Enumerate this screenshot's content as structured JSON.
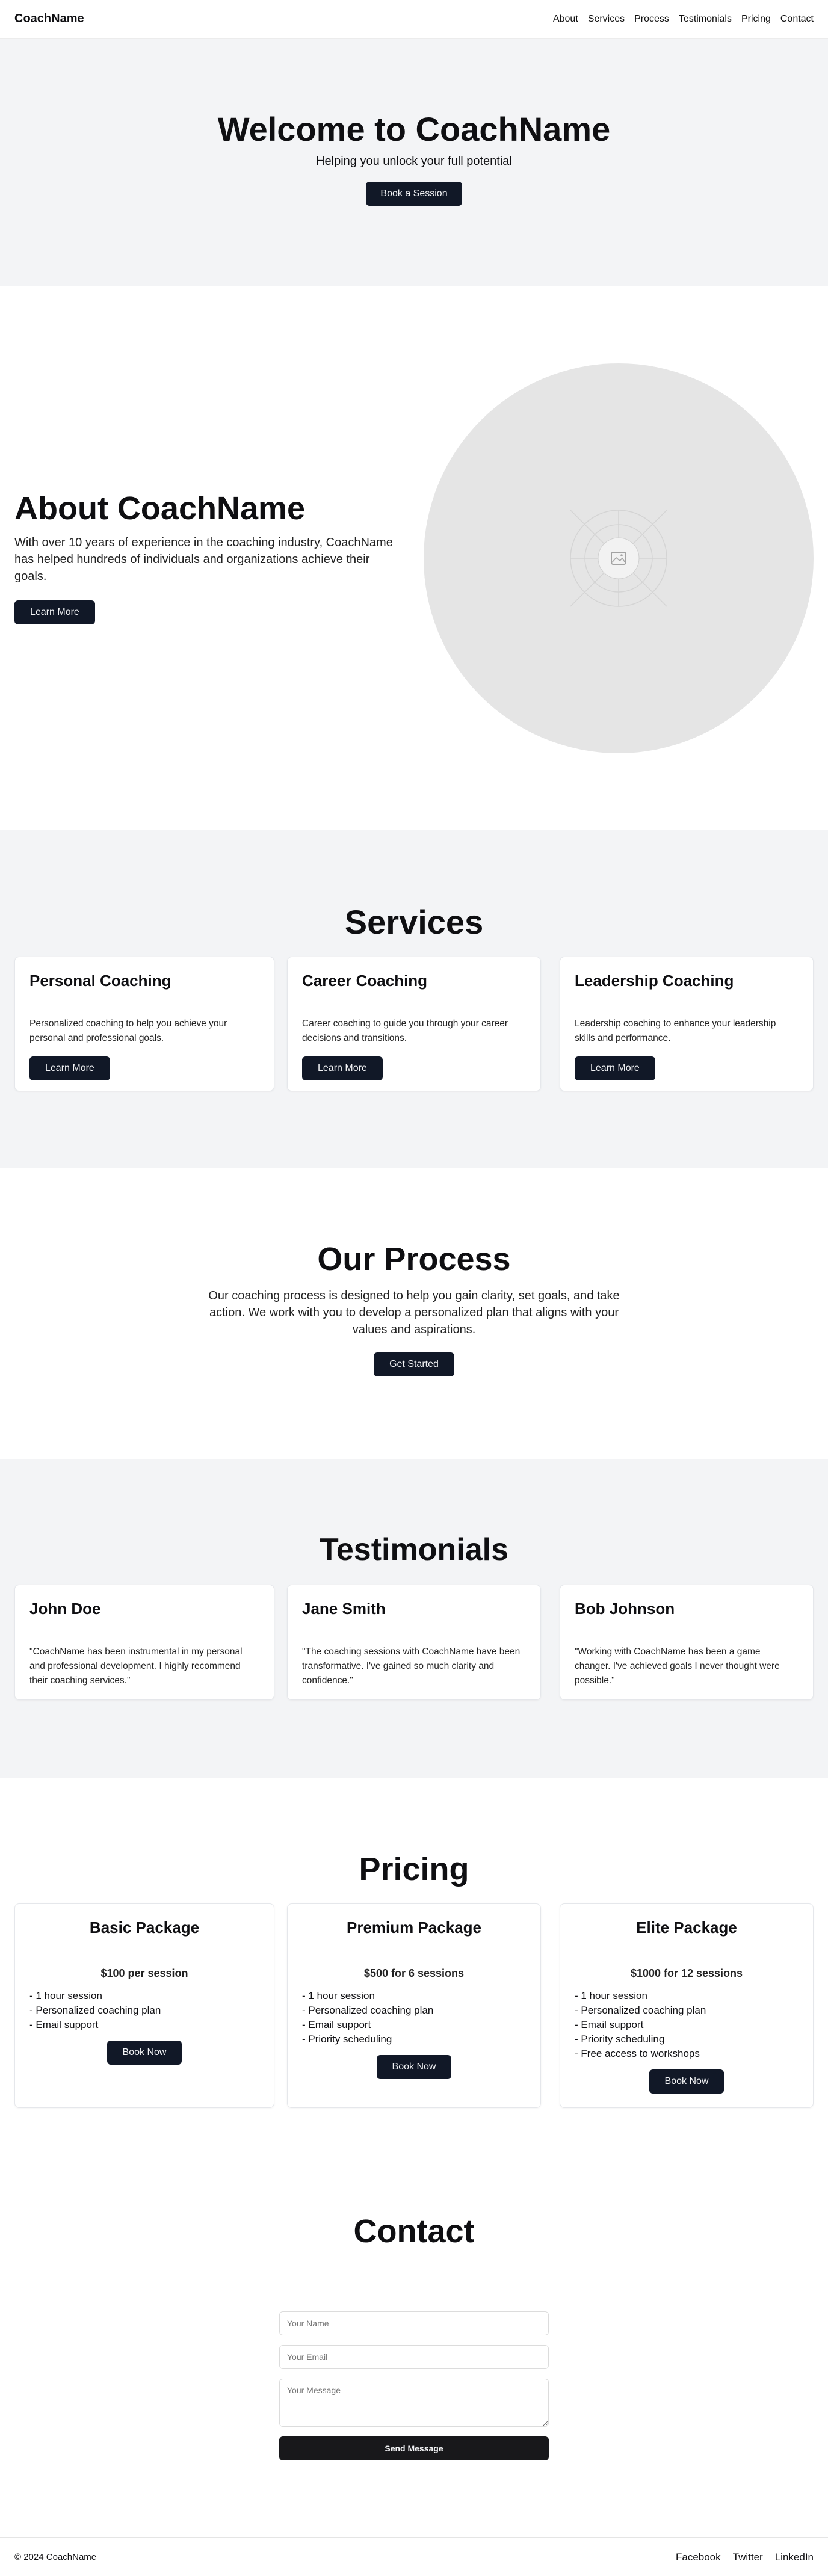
{
  "header": {
    "logo": "CoachName",
    "nav": [
      "About",
      "Services",
      "Process",
      "Testimonials",
      "Pricing",
      "Contact"
    ]
  },
  "hero": {
    "title": "Welcome to CoachName",
    "subtitle": "Helping you unlock your full potential",
    "cta": "Book a Session"
  },
  "about": {
    "title": "About CoachName",
    "text": "With over 10 years of experience in the coaching industry, CoachName has helped hundreds of individuals and organizations achieve their goals.",
    "cta": "Learn More",
    "image_icon": "image-placeholder-icon"
  },
  "services": {
    "title": "Services",
    "items": [
      {
        "title": "Personal Coaching",
        "text": "Personalized coaching to help you achieve your personal and professional goals.",
        "cta": "Learn More"
      },
      {
        "title": "Career Coaching",
        "text": "Career coaching to guide you through your career decisions and transitions.",
        "cta": "Learn More"
      },
      {
        "title": "Leadership Coaching",
        "text": "Leadership coaching to enhance your leadership skills and performance.",
        "cta": "Learn More"
      }
    ]
  },
  "process": {
    "title": "Our Process",
    "text": "Our coaching process is designed to help you gain clarity, set goals, and take action. We work with you to develop a personalized plan that aligns with your values and aspirations.",
    "cta": "Get Started"
  },
  "testimonials": {
    "title": "Testimonials",
    "items": [
      {
        "name": "John Doe",
        "quote": "\"CoachName has been instrumental in my personal and professional development. I highly recommend their coaching services.\""
      },
      {
        "name": "Jane Smith",
        "quote": "\"The coaching sessions with CoachName have been transformative. I've gained so much clarity and confidence.\""
      },
      {
        "name": "Bob Johnson",
        "quote": "\"Working with CoachName has been a game changer. I've achieved goals I never thought were possible.\""
      }
    ]
  },
  "pricing": {
    "title": "Pricing",
    "items": [
      {
        "name": "Basic Package",
        "price": "$100 per session",
        "features": [
          "- 1 hour session",
          "- Personalized coaching plan",
          "- Email support"
        ],
        "cta": "Book Now"
      },
      {
        "name": "Premium Package",
        "price": "$500 for 6 sessions",
        "features": [
          "- 1 hour session",
          "- Personalized coaching plan",
          "- Email support",
          "- Priority scheduling"
        ],
        "cta": "Book Now"
      },
      {
        "name": "Elite Package",
        "price": "$1000 for 12 sessions",
        "features": [
          "- 1 hour session",
          "- Personalized coaching plan",
          "- Email support",
          "- Priority scheduling",
          "- Free access to workshops"
        ],
        "cta": "Book Now"
      }
    ]
  },
  "contact": {
    "title": "Contact",
    "name_placeholder": "Your Name",
    "email_placeholder": "Your Email",
    "message_placeholder": "Your Message",
    "submit": "Send Message"
  },
  "footer": {
    "copyright": "© 2024 CoachName",
    "links": [
      "Facebook",
      "Twitter",
      "LinkedIn"
    ]
  },
  "colors": {
    "primary": "#111827",
    "section_bg": "#f3f4f6",
    "placeholder_image": "#e5e5e5"
  }
}
